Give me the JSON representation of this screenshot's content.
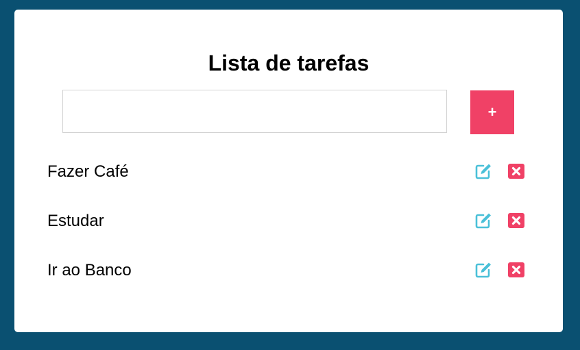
{
  "title": "Lista de tarefas",
  "input": {
    "value": "",
    "placeholder": ""
  },
  "add_button": {
    "label": "+",
    "color": "#f04166"
  },
  "colors": {
    "background": "#0a5071",
    "card": "#ffffff",
    "edit_icon": "#4ac0d8",
    "delete_icon": "#f04166"
  },
  "tasks": [
    {
      "label": "Fazer Café",
      "edit_icon": "edit-icon",
      "delete_icon": "close-icon"
    },
    {
      "label": "Estudar",
      "edit_icon": "edit-icon",
      "delete_icon": "close-icon"
    },
    {
      "label": "Ir ao Banco",
      "edit_icon": "edit-icon",
      "delete_icon": "close-icon"
    }
  ]
}
